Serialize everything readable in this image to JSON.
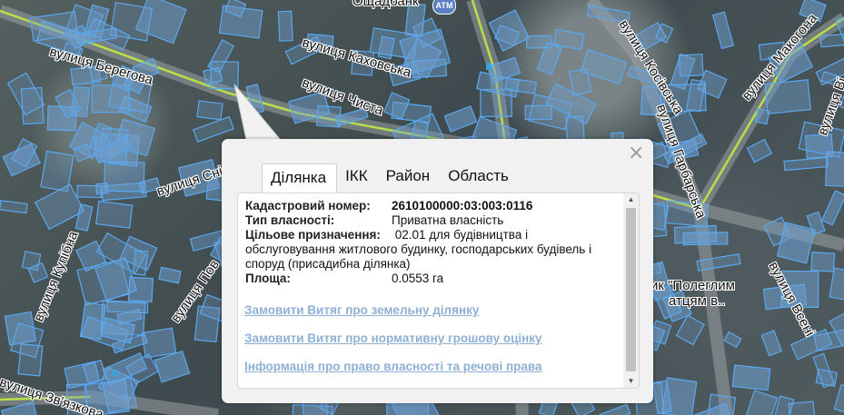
{
  "map": {
    "streets": [
      "вулиця Берегова",
      "вулиця Каховська",
      "вулиця Чиста",
      "вулиця Сні",
      "вулиця Купібна",
      "вулиця Пов",
      "вулиця Зв'язкова",
      "вулиця Косівська",
      "вулиця Макогона",
      "вулиця Гарбарська",
      "вулиця Всені",
      "вулиця Ві"
    ],
    "pois": [
      "Ощадбанк",
      "АТМ",
      "ик \"Полеглим",
      "атцям в.."
    ],
    "colors": {
      "parcel_fill": "#6e9fd0",
      "parcel_stroke": "#5aa8f0",
      "road_line": "#b6e04a"
    }
  },
  "popup": {
    "close": "×",
    "tabs": [
      "Ділянка",
      "ІКК",
      "Район",
      "Область"
    ],
    "active_tab": "Ділянка",
    "fields": [
      {
        "label": "Кадастровий номер:",
        "value": "2610100000:03:003:0116"
      },
      {
        "label": "Тип власності:",
        "value": "Приватна власність"
      },
      {
        "label": "Цільове призначення:",
        "value": "02.01 для будівництва і обслуговування житлового будинку, господарських будівель і споруд (присадибна ділянка)"
      },
      {
        "label": "Площа:",
        "value": "0.0553 га"
      }
    ],
    "links": [
      "Замовити Витяг про земельну ділянку",
      "Замовити Витяг про нормативну грошову оцінку",
      "Інформація про право власності та речові права"
    ],
    "scroll_icons": [
      "scroll-up-icon",
      "scroll-down-icon"
    ]
  }
}
